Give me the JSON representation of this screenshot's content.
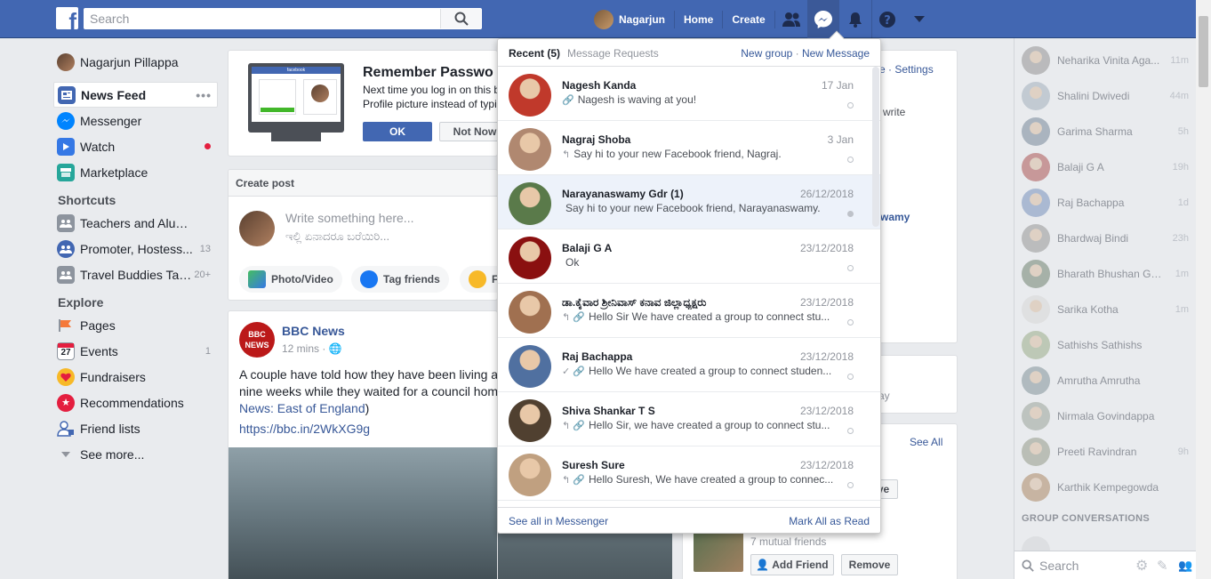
{
  "header": {
    "search_placeholder": "Search",
    "user_name": "Nagarjun",
    "home": "Home",
    "create": "Create"
  },
  "sidebar": {
    "profile_name": "Nagarjun Pillappa",
    "main": [
      {
        "label": "News Feed",
        "icon_color": "#4267b2"
      },
      {
        "label": "Messenger",
        "icon_color": "#0084ff"
      },
      {
        "label": "Watch",
        "icon_color": "#3578e5"
      },
      {
        "label": "Marketplace",
        "icon_color": "#26a69a"
      }
    ],
    "shortcuts_title": "Shortcuts",
    "shortcuts": [
      {
        "label": "Teachers and Alum...",
        "count": ""
      },
      {
        "label": "Promoter, Hostess...",
        "count": "13"
      },
      {
        "label": "Travel Buddies Talk...",
        "count": "20+"
      }
    ],
    "explore_title": "Explore",
    "explore": [
      {
        "label": "Pages",
        "count": ""
      },
      {
        "label": "Events",
        "count": "1"
      },
      {
        "label": "Fundraisers",
        "count": ""
      },
      {
        "label": "Recommendations",
        "count": ""
      },
      {
        "label": "Friend lists",
        "count": ""
      }
    ],
    "see_more": "See more..."
  },
  "remember_password": {
    "title": "Remember Passwo",
    "line1": "Next time you log in on this b",
    "line2": "Profile picture instead of typi",
    "ok": "OK",
    "not_now": "Not Now",
    "screen_label": "facebook"
  },
  "create_post": {
    "title": "Create post",
    "placeholder1": "Write something here...",
    "placeholder2": "ಇಲ್ಲಿ ಏನಾದರೂ ಬರೆಯಿರಿ...",
    "photo_video": "Photo/Video",
    "tag_friends": "Tag friends",
    "feeling": "Fe"
  },
  "post": {
    "logo_line1": "BBC",
    "logo_line2": "NEWS",
    "author": "BBC News",
    "time": "12 mins · ",
    "line1": "A couple have told how they have been living a",
    "line2": "nine weeks while they waited for a council hom",
    "line3": "News: East of England",
    "line3_tail": ")",
    "url": "https://bbc.in/2WkXG9g"
  },
  "right_col": {
    "settings_partial": "ve · Settings",
    "write": "write",
    "wamy": "wamy",
    "ay": "ay",
    "see_all": "See All",
    "ve": "ve",
    "mutual": "7 mutual friends",
    "add_friend": "Add Friend",
    "remove": "Remove"
  },
  "messenger": {
    "tab_recent": "Recent",
    "recent_count": "(5)",
    "tab_requests": "Message Requests",
    "new_group": "New group",
    "sep": " · ",
    "new_message": "New Message",
    "see_all": "See all in Messenger",
    "mark_all": "Mark All as Read",
    "messages": [
      {
        "name": "Nagesh Kanda",
        "date": "17 Jan",
        "icon": "🔗",
        "snippet": "Nagesh is waving at you!",
        "highlight": false,
        "color": "#c0392b"
      },
      {
        "name": "Nagraj Shoba",
        "date": "3 Jan",
        "icon": "↰",
        "snippet": "Say hi to your new Facebook friend, Nagraj.",
        "highlight": false,
        "color": "#b08870"
      },
      {
        "name": "Narayanaswamy Gdr (1)",
        "date": "26/12/2018",
        "icon": "",
        "snippet": "Say hi to your new Facebook friend, Narayanaswamy.",
        "highlight": true,
        "color": "#5a7a4a"
      },
      {
        "name": "Balaji G A",
        "date": "23/12/2018",
        "icon": "",
        "snippet": "Ok",
        "highlight": false,
        "color": "#8a1010"
      },
      {
        "name": "ಡಾ.ಕೈವಾರ ಶ್ರೀನಿವಾಸ್ ಕನಾವ ಜಿಲ್ಲಾಧ್ಯಕ್ಷರು",
        "date": "23/12/2018",
        "icon": "↰ 🔗",
        "snippet": "Hello Sir We have created a group to connect stu...",
        "highlight": false,
        "color": "#a07050"
      },
      {
        "name": "Raj Bachappa",
        "date": "23/12/2018",
        "icon": "✓ 🔗",
        "snippet": "Hello We have created a group to connect studen...",
        "highlight": false,
        "color": "#5070a0"
      },
      {
        "name": "Shiva Shankar T S",
        "date": "23/12/2018",
        "icon": "↰ 🔗",
        "snippet": "Hello Sir, we have created a group to connect stu...",
        "highlight": false,
        "color": "#504030"
      },
      {
        "name": "Suresh Sure",
        "date": "23/12/2018",
        "icon": "↰ 🔗",
        "snippet": "Hello Suresh, We have created a group to connec...",
        "highlight": false,
        "color": "#c0a080"
      }
    ]
  },
  "chat": {
    "contacts": [
      {
        "name": "Neharika Vinita Aga...",
        "time": "11m",
        "color": "#9a9a9a"
      },
      {
        "name": "Shalini Dwivedi",
        "time": "44m",
        "color": "#a8b4c0"
      },
      {
        "name": "Garima Sharma",
        "time": "5h",
        "color": "#8090a0"
      },
      {
        "name": "Balaji G A",
        "time": "19h",
        "color": "#b06060"
      },
      {
        "name": "Raj Bachappa",
        "time": "1d",
        "color": "#8098c0"
      },
      {
        "name": "Bhardwaj Bindi",
        "time": "23h",
        "color": "#9c9c9c"
      },
      {
        "name": "Bharath Bhushan Go...",
        "time": "1m",
        "color": "#7a8a7a"
      },
      {
        "name": "Sarika Kotha",
        "time": "1m",
        "color": "#d8d8d8"
      },
      {
        "name": "Sathishs Sathishs",
        "time": "",
        "color": "#a0b090"
      },
      {
        "name": "Amrutha Amrutha",
        "time": "",
        "color": "#8a9aa0"
      },
      {
        "name": "Nirmala Govindappa",
        "time": "",
        "color": "#a0a8a0"
      },
      {
        "name": "Preeti Ravindran",
        "time": "9h",
        "color": "#9aa090"
      },
      {
        "name": "Karthik Kempegowda",
        "time": "",
        "color": "#b09070"
      }
    ],
    "group_title": "GROUP CONVERSATIONS",
    "search_placeholder": "Search"
  }
}
